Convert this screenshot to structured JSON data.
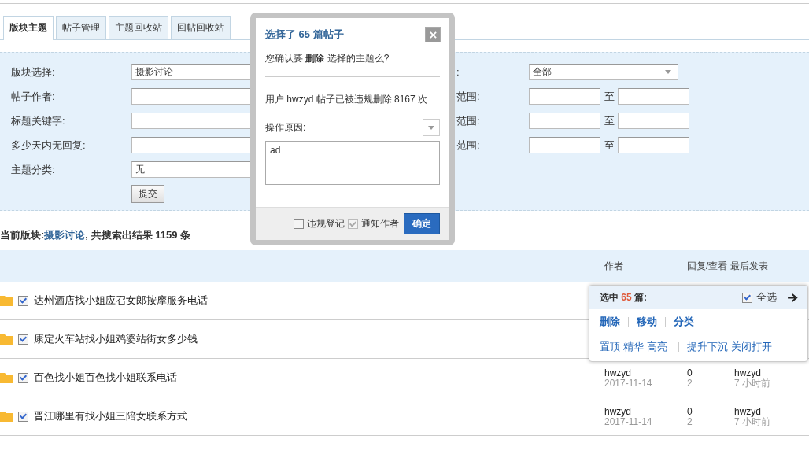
{
  "tabs": [
    {
      "label": "版块主题",
      "selected": true
    },
    {
      "label": "帖子管理",
      "selected": false
    },
    {
      "label": "主题回收站",
      "selected": false
    },
    {
      "label": "回帖回收站",
      "selected": false
    }
  ],
  "filters_left": [
    {
      "label": "版块选择:",
      "kind": "select",
      "value": "摄影讨论"
    },
    {
      "label": "帖子作者:",
      "kind": "text"
    },
    {
      "label": "标题关键字:",
      "kind": "text"
    },
    {
      "label": "多少天内无回复:",
      "kind": "text"
    },
    {
      "label": "主题分类:",
      "kind": "select",
      "value": "无"
    }
  ],
  "filters_right": [
    {
      "label": ":",
      "kind": "select",
      "value": "全部"
    },
    {
      "label": "范围:",
      "kind": "range",
      "separator": "至"
    },
    {
      "label": "范围:",
      "kind": "range",
      "separator": "至"
    },
    {
      "label": "范围:",
      "kind": "range",
      "separator": "至"
    }
  ],
  "submit_button": "提交",
  "summary": {
    "prefix": "当前版块:",
    "forum": "摄影讨论",
    "suffix": ", 共搜索出结果 1159 条"
  },
  "table": {
    "columns": [
      "作者",
      "回复/查看 最后发表"
    ],
    "rows": [
      {
        "title": "达州酒店找小姐应召女郎按摩服务电话",
        "checked": true
      },
      {
        "title": "康定火车站找小姐鸡婆站街女多少钱",
        "checked": true
      },
      {
        "title": "百色找小姐百色找小姐联系电话",
        "checked": true,
        "author": "hwzyd",
        "date": "2017-11-14",
        "replies": "0",
        "views": "2",
        "last_poster": "hwzyd",
        "last_time": "7 小时前"
      },
      {
        "title": "晋江哪里有找小姐三陪女联系方式",
        "checked": true,
        "author": "hwzyd",
        "date": "2017-11-14",
        "replies": "0",
        "views": "2",
        "last_poster": "hwzyd",
        "last_time": "7 小时前"
      }
    ]
  },
  "dialog": {
    "title": "选择了 65 篇帖子",
    "question": "您确认要 **删除** 选择的主题么?",
    "notice": "用户 hwzyd 帖子已被违规删除 8167 次",
    "reason_label": "操作原因:",
    "reason": "ad",
    "options": [
      {
        "label": "违规登记",
        "checked": false,
        "disabled": false
      },
      {
        "label": "通知作者",
        "checked": true,
        "disabled": true
      }
    ],
    "confirm_button": "确定"
  },
  "selection_panel": {
    "prefix": "选中",
    "count": "65",
    "suffix": "篇:",
    "select_all": {
      "label": "全选",
      "checked": true
    },
    "primary_actions": [
      "删除",
      "移动",
      "分类"
    ],
    "secondary_groups": [
      [
        "置顶",
        "精华",
        "高亮"
      ],
      [
        "提升下沉",
        "关闭打开"
      ]
    ]
  }
}
